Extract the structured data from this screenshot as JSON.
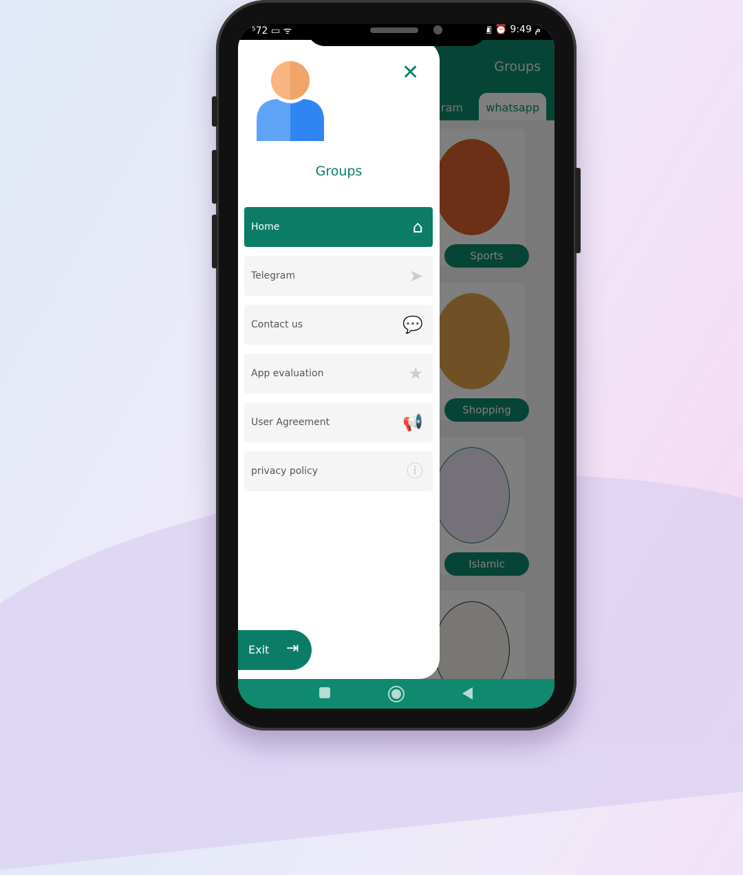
{
  "status_bar": {
    "left": "⁵72 ▭ ᯤ",
    "right": "▣ ⏰ م 9:49"
  },
  "app": {
    "title": "Groups",
    "tabs": [
      {
        "label": "ram"
      },
      {
        "label": "whatsapp",
        "active": true
      }
    ],
    "cards": [
      {
        "label": "Sports"
      },
      {
        "label": "Shopping"
      },
      {
        "label": "Islamic"
      },
      {
        "label": ""
      }
    ]
  },
  "drawer": {
    "title": "Groups",
    "close_icon": "close-icon",
    "items": [
      {
        "label": "Home",
        "icon": "home-icon",
        "active": true
      },
      {
        "label": "Telegram",
        "icon": "paper-plane-icon"
      },
      {
        "label": "Contact us",
        "icon": "chat-bubbles-icon"
      },
      {
        "label": "App evaluation",
        "icon": "star-icon"
      },
      {
        "label": "User Agreement",
        "icon": "megaphone-icon"
      },
      {
        "label": "privacy policy",
        "icon": "info-icon"
      }
    ],
    "exit_label": "Exit"
  },
  "colors": {
    "accent": "#0b7d66",
    "navbar": "#0f8a6e"
  }
}
